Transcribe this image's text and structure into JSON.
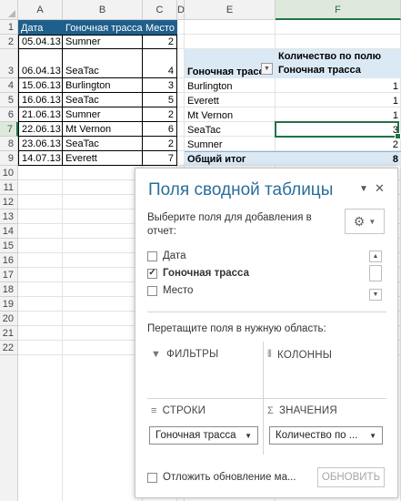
{
  "sheet": {
    "columns": [
      "A",
      "B",
      "C",
      "D",
      "E",
      "F"
    ],
    "rows": [
      "1",
      "2",
      "3",
      "4",
      "5",
      "6",
      "7",
      "8",
      "9",
      "10",
      "11",
      "12",
      "13",
      "14",
      "15",
      "16",
      "17",
      "18",
      "19",
      "20",
      "21",
      "22"
    ],
    "source_table": {
      "headers": [
        "Дата",
        "Гоночная трасса",
        "Место"
      ],
      "rows": [
        [
          "05.04.13",
          "Sumner",
          "2"
        ],
        [
          "06.04.13",
          "SeaTac",
          "4"
        ],
        [
          "15.06.13",
          "Burlington",
          "3"
        ],
        [
          "16.06.13",
          "SeaTac",
          "5"
        ],
        [
          "21.06.13",
          "Sumner",
          "2"
        ],
        [
          "22.06.13",
          "Mt Vernon",
          "6"
        ],
        [
          "23.06.13",
          "SeaTac",
          "2"
        ],
        [
          "14.07.13",
          "Everett",
          "7"
        ]
      ]
    },
    "pivot": {
      "values_header_line1": "Количество по полю",
      "values_header_line2": "Гоночная трасса",
      "row_header": "Гоночная трасса",
      "rows": [
        [
          "Burlington",
          "1"
        ],
        [
          "Everett",
          "1"
        ],
        [
          "Mt Vernon",
          "1"
        ],
        [
          "SeaTac",
          "3"
        ],
        [
          "Sumner",
          "2"
        ]
      ],
      "total_label": "Общий итог",
      "total_value": "8"
    }
  },
  "pane": {
    "title": "Поля сводной таблицы",
    "dropdown_glyph": "▼",
    "close_glyph": "✕",
    "choose_fields_label": "Выберите поля для добавления в отчет:",
    "gear_glyph": "⚙",
    "fields": [
      {
        "label": "Дата",
        "checked": false,
        "mark": ""
      },
      {
        "label": "Гоночная трасса",
        "checked": true,
        "mark": "✓"
      },
      {
        "label": "Место",
        "checked": false,
        "mark": ""
      }
    ],
    "drag_label": "Перетащите поля в нужную область:",
    "zones": {
      "filters": "ФИЛЬТРЫ",
      "columns": "КОЛОННЫ",
      "rows": "СТРОКИ",
      "values": "ЗНАЧЕНИЯ"
    },
    "rows_pill": "Гоночная трасса",
    "values_pill": "Количество по ...",
    "defer_label": "Отложить обновление ма...",
    "update_button": "ОБНОВИТЬ"
  },
  "colors": {
    "table_header_bg": "#1f5f8b",
    "pivot_header_bg": "#dbe9f5",
    "selection": "#217346",
    "pane_title": "#2b6d9c"
  }
}
